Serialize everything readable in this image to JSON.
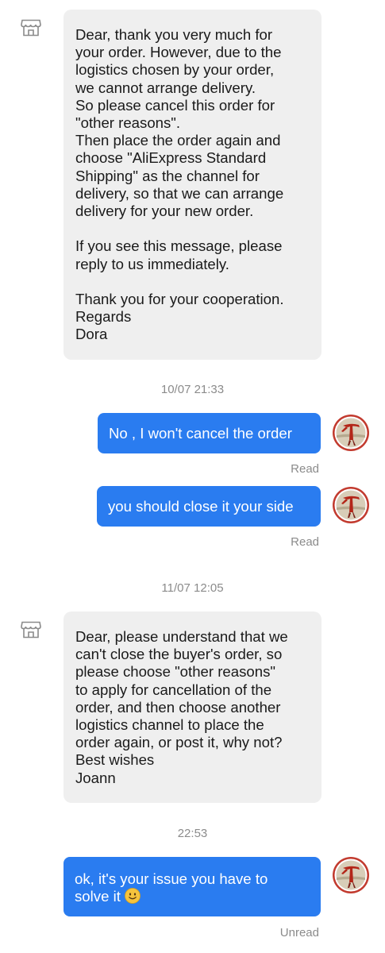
{
  "conversation": {
    "messages": [
      {
        "from": "seller",
        "text": "Dear, thank you very much for\nyour order. However, due to the\nlogistics chosen by your order,\nwe cannot arrange delivery.\nSo please cancel this order for\n\"other reasons\".\nThen place the order again and\nchoose \"AliExpress Standard\nShipping\" as the channel for\ndelivery, so that we can arrange\ndelivery for your new order.\n\nIf you see this message, please\nreply to us immediately.\n\nThank you for your cooperation.\nRegards\nDora",
        "icon": "shop-icon"
      },
      {
        "timestamp": "10/07 21:33"
      },
      {
        "from": "buyer",
        "text": "No , I won't cancel the order",
        "status": "Read"
      },
      {
        "from": "buyer",
        "text": "you should close it your side",
        "status": "Read"
      },
      {
        "timestamp": "11/07 12:05"
      },
      {
        "from": "seller",
        "text": "Dear, please understand that we\ncan't close the buyer's order, so\nplease choose \"other reasons\"\nto apply for cancellation of the\norder, and then choose another\nlogistics channel to place the\norder again, or post it, why not?\nBest wishes\nJoann",
        "icon": "shop-icon"
      },
      {
        "timestamp": "22:53"
      },
      {
        "from": "buyer",
        "text": "ok, it's your issue you have to\nsolve it ",
        "emoji": "slightly-smiling-face-icon",
        "status": "Unread"
      }
    ]
  },
  "colors": {
    "seller_bubble": "#efefef",
    "buyer_bubble": "#2a7cf0",
    "meta_text": "#8b8b8b"
  }
}
